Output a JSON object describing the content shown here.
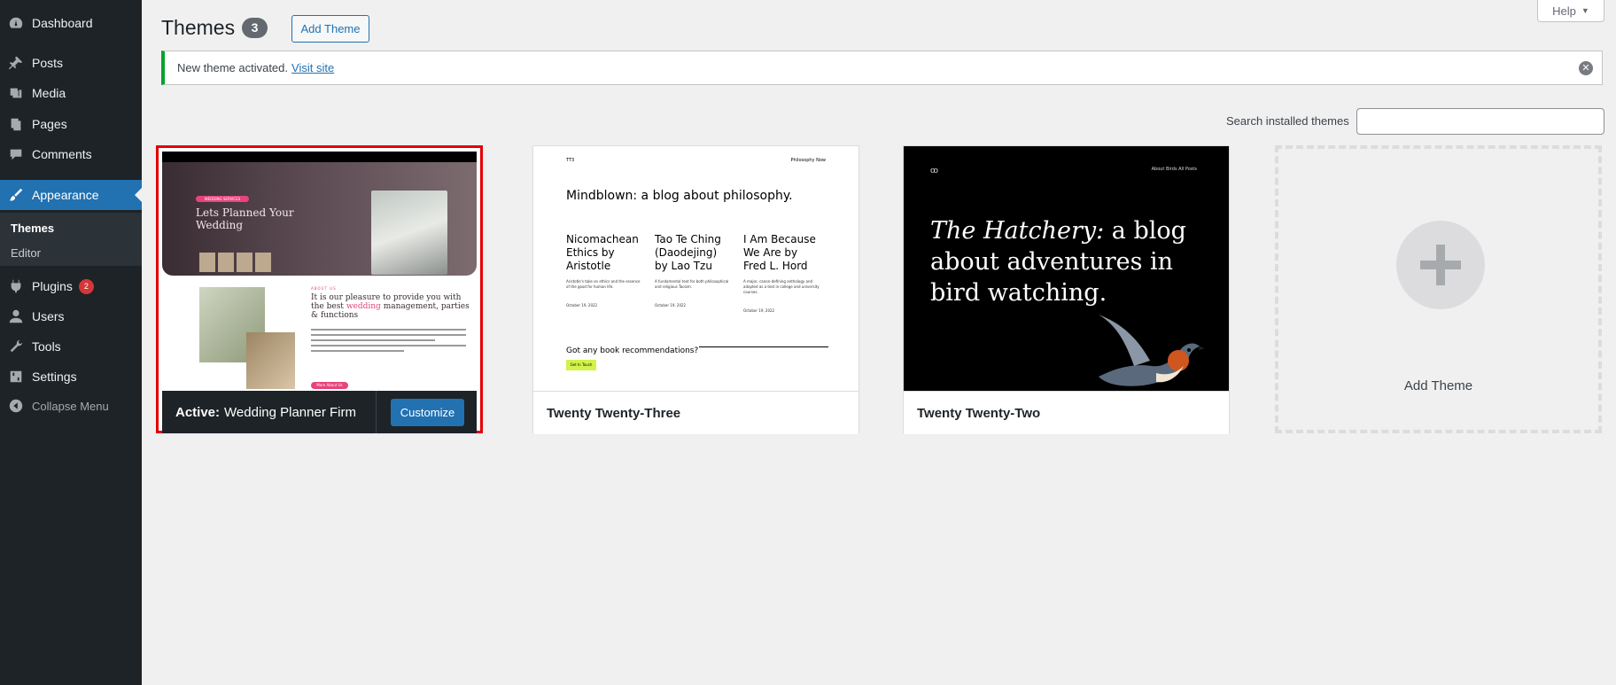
{
  "sidebar": {
    "items": [
      {
        "label": "Dashboard",
        "icon": "dashboard-icon"
      },
      {
        "label": "Posts",
        "icon": "pin-icon"
      },
      {
        "label": "Media",
        "icon": "media-icon"
      },
      {
        "label": "Pages",
        "icon": "pages-icon"
      },
      {
        "label": "Comments",
        "icon": "comment-icon"
      },
      {
        "label": "Appearance",
        "icon": "brush-icon"
      },
      {
        "label": "Plugins",
        "icon": "plugin-icon",
        "badge": "2"
      },
      {
        "label": "Users",
        "icon": "user-icon"
      },
      {
        "label": "Tools",
        "icon": "wrench-icon"
      },
      {
        "label": "Settings",
        "icon": "settings-icon"
      }
    ],
    "submenu": [
      "Themes",
      "Editor"
    ],
    "collapse": "Collapse Menu"
  },
  "header": {
    "title": "Themes",
    "count": "3",
    "add_button": "Add Theme",
    "help": "Help"
  },
  "notice": {
    "text": "New theme activated.",
    "link": "Visit site"
  },
  "search": {
    "label": "Search installed themes",
    "value": ""
  },
  "themes": [
    {
      "active_prefix": "Active:",
      "name": "Wedding Planner Firm",
      "customize": "Customize",
      "shot": {
        "pill": "WEDDING SERVICES",
        "heading": "Lets Planned Your Wedding",
        "about": "ABOUT US",
        "text_a": "It is our pleasure to provide you with the best",
        "text_em": "wedding",
        "text_b": "management, parties & functions",
        "more": "More About Us"
      }
    },
    {
      "name": "Twenty Twenty-Three",
      "shot": {
        "site": "TT3",
        "nav": "Philosophy   Now",
        "h1": "Mindblown: a blog about philosophy.",
        "cols": [
          {
            "title": "Nicomachean Ethics by Aristotle",
            "desc": "Aristotle's take on ethics and the essence of the good for human life.",
            "date": "October 19, 2022"
          },
          {
            "title": "Tao Te Ching (Daodejing) by Lao Tzu",
            "desc": "A fundamental text for both philosophical and religious Taoism.",
            "date": "October 19, 2022"
          },
          {
            "title": "I Am Because We Are by Fred L. Hord",
            "desc": "A major, canon-defining anthology and adopted as a text in college and university courses.",
            "date": "October 19, 2022"
          }
        ],
        "question": "Got any book recommendations?",
        "button": "Get In Touch"
      }
    },
    {
      "name": "Twenty Twenty-Two",
      "shot": {
        "logo": "ꝏ",
        "nav": "About     Birds     All Posts",
        "head_em": "The Hatchery:",
        "head_rest": "a blog about adventures in bird watching."
      }
    }
  ],
  "add_theme_card": {
    "label": "Add Theme"
  },
  "colors": {
    "sidebar": "#1d2327",
    "accent": "#2271b1",
    "active_outline": "#e30000",
    "notice_success": "#00a32a",
    "badge": "#d63638"
  }
}
